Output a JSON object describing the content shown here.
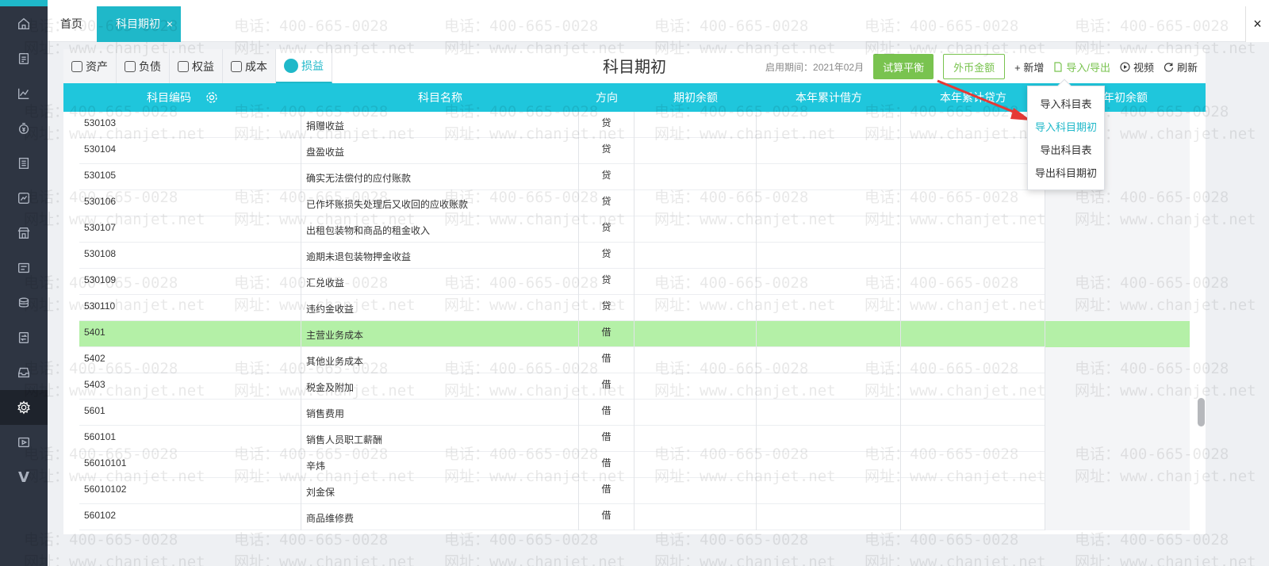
{
  "nav": {
    "icons": [
      "home-icon",
      "voucher-icon",
      "chart-icon",
      "money-icon",
      "ledger-icon",
      "report-icon",
      "store-icon",
      "invoice-icon",
      "coins-icon",
      "transfer-icon",
      "inbox-icon",
      "gear-icon",
      "video-icon",
      "v-icon"
    ],
    "v_letter": "V"
  },
  "tabs": {
    "home": "首页",
    "current": "科目期初",
    "close": "×",
    "window_close": "×"
  },
  "subtabs": [
    "资产",
    "负债",
    "权益",
    "成本",
    "损益"
  ],
  "page": {
    "title": "科目期初",
    "period": "启用期间：2021年02月",
    "trial_balance": "试算平衡",
    "foreign_currency": "外币金额",
    "add": "+ 新增",
    "import_export": "导入/导出",
    "video": "视频",
    "refresh": "刷新"
  },
  "table": {
    "headers": [
      "科目编码",
      "科目名称",
      "方向",
      "期初余额",
      "本年累计借方",
      "本年累计贷方",
      "年初余额"
    ],
    "rows": [
      {
        "code": "530103",
        "name": "捐赠收益",
        "dir": "贷"
      },
      {
        "code": "530104",
        "name": "盘盈收益",
        "dir": "贷"
      },
      {
        "code": "530105",
        "name": "确实无法偿付的应付账款",
        "dir": "贷"
      },
      {
        "code": "530106",
        "name": "已作坏账损失处理后又收回的应收账款",
        "dir": "贷"
      },
      {
        "code": "530107",
        "name": "出租包装物和商品的租金收入",
        "dir": "贷"
      },
      {
        "code": "530108",
        "name": "逾期未退包装物押金收益",
        "dir": "贷"
      },
      {
        "code": "530109",
        "name": "汇兑收益",
        "dir": "贷"
      },
      {
        "code": "530110",
        "name": "违约金收益",
        "dir": "贷"
      },
      {
        "code": "5401",
        "name": "主营业务成本",
        "dir": "借"
      },
      {
        "code": "5402",
        "name": "其他业务成本",
        "dir": "借"
      },
      {
        "code": "5403",
        "name": "税金及附加",
        "dir": "借"
      },
      {
        "code": "5601",
        "name": "销售费用",
        "dir": "借"
      },
      {
        "code": "560101",
        "name": "销售人员职工薪酬",
        "dir": "借"
      },
      {
        "code": "56010101",
        "name": "辛炜",
        "dir": "借"
      },
      {
        "code": "56010102",
        "name": "刘金保",
        "dir": "借"
      },
      {
        "code": "560102",
        "name": "商品维修费",
        "dir": "借"
      }
    ],
    "selected_index": 8
  },
  "dropdown": {
    "items": [
      "导入科目表",
      "导入科目期初",
      "导出科目表",
      "导出科目期初"
    ],
    "highlight_index": 1
  },
  "watermark": {
    "phone": "电话：400-665-0028",
    "site": "网址：www.chanjet.net"
  },
  "colors": {
    "accent": "#1fb8c9",
    "header": "#1fc6dc",
    "green": "#79c34f",
    "selected_row": "#b4f0a7",
    "nav_bg": "#2e3542",
    "arrow": "#e53935"
  }
}
